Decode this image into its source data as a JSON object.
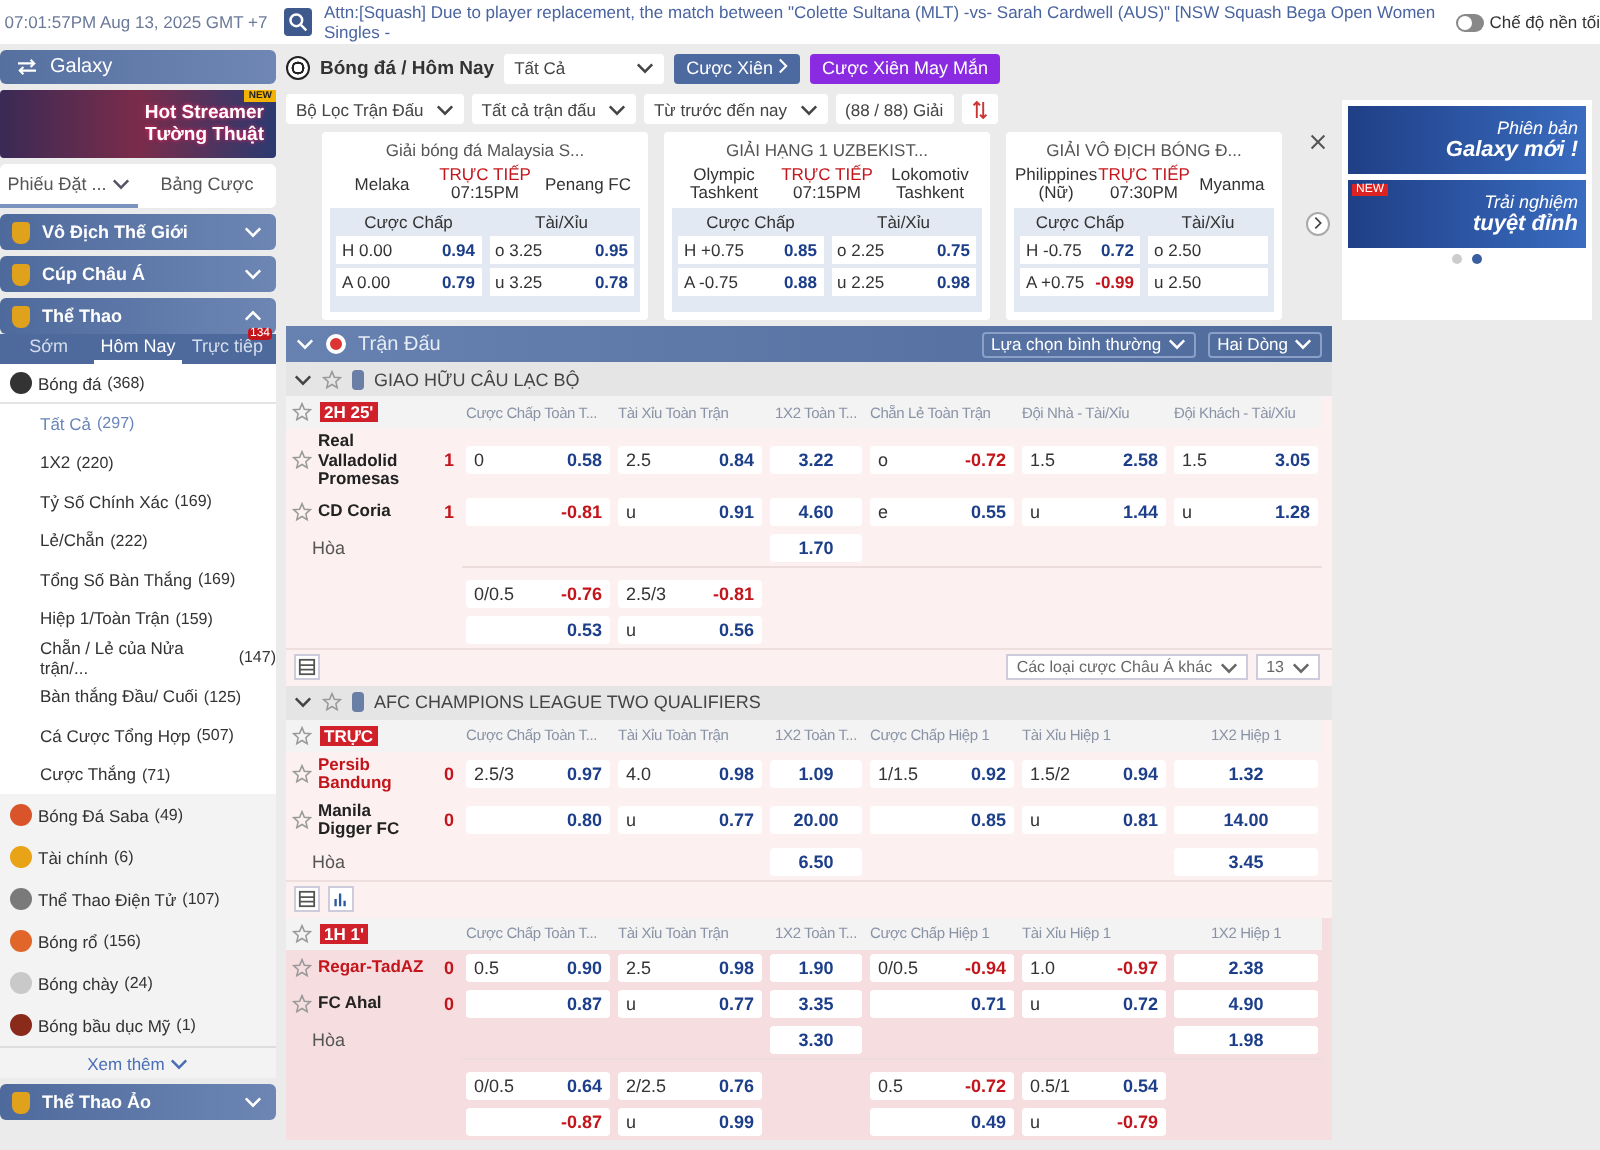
{
  "top_bar": {
    "clock": "07:01:57PM Aug 13, 2025 GMT +7",
    "ticker": "Attn:[Squash] Due to player replacement, the match between \"Colette Sultana (MLT) -vs- Sarah Cardwell (AUS)\" [NSW Squash Bega Open Women Singles -",
    "dark_mode": {
      "label": "Chế độ nền tối",
      "on": false
    }
  },
  "sidebar": {
    "brand": "Galaxy",
    "promo": {
      "badge": "NEW",
      "title": "Hot Streamer",
      "subtitle": "Tường Thuật"
    },
    "slip_tabs": [
      {
        "label": "Phiếu Đặt ...",
        "selected": true
      },
      {
        "label": "Bảng Cược",
        "selected": false
      }
    ],
    "sections": [
      {
        "title": "Vô Địch Thế Giới",
        "expanded": false
      },
      {
        "title": "Cúp Châu Á",
        "expanded": false
      },
      {
        "title": "Thể Thao",
        "expanded": true,
        "tabs": [
          {
            "label": "Sớm",
            "selected": false
          },
          {
            "label": "Hôm Nay",
            "selected": true
          },
          {
            "label": "Trực tiếp",
            "selected": false,
            "badge": "134"
          }
        ],
        "sports": [
          {
            "kind": "soccer",
            "name": "Bóng đá",
            "count": "(368)",
            "expanded": true,
            "children": [
              {
                "name": "Tất Cả",
                "count": "(297)",
                "selected": true
              },
              {
                "name": "1X2",
                "count": "(220)",
                "selected": false
              },
              {
                "name": "Tỷ Số Chính Xác",
                "count": "(169)",
                "selected": false
              },
              {
                "name": "Lẻ/Chẵn",
                "count": "(222)",
                "selected": false
              },
              {
                "name": "Tổng Số Bàn Thắng",
                "count": "(169)",
                "selected": false
              },
              {
                "name": "Hiệp 1/Toàn Trận",
                "count": "(159)",
                "selected": false
              },
              {
                "name": "Chẵn / Lẻ của Nửa trận/...",
                "count": "(147)",
                "selected": false
              },
              {
                "name": "Bàn thắng Đầu/ Cuối",
                "count": "(125)",
                "selected": false
              },
              {
                "name": "Cá Cược Tổng Hợp",
                "count": "(507)",
                "selected": false
              },
              {
                "name": "Cược Thắng",
                "count": "(71)",
                "selected": false
              }
            ]
          },
          {
            "kind": "saba",
            "name": "Bóng Đá Saba",
            "count": "(49)",
            "expanded": false
          },
          {
            "kind": "finance",
            "name": "Tài chính",
            "count": "(6)",
            "expanded": false
          },
          {
            "kind": "esports",
            "name": "Thể Thao Điện Tử",
            "count": "(107)",
            "expanded": false
          },
          {
            "kind": "basketball",
            "name": "Bóng rổ",
            "count": "(156)",
            "expanded": false
          },
          {
            "kind": "baseball",
            "name": "Bóng chày",
            "count": "(24)",
            "expanded": false
          },
          {
            "kind": "football",
            "name": "Bóng bầu dục Mỹ",
            "count": "(1)",
            "expanded": false
          }
        ],
        "more": "Xem thêm"
      },
      {
        "title": "Thể Thao Ảo",
        "expanded": false
      }
    ]
  },
  "main": {
    "header": {
      "title": "Bóng đá / Hôm Nay",
      "market_select": "Tất Cả",
      "parlay": "Cược Xiên",
      "lucky_parlay": "Cược Xiên May Mắn"
    },
    "filters": [
      "Bộ Lọc Trận Đấu",
      "Tất cả trận đấu",
      "Từ trước đến nay"
    ],
    "league_count": "(88 / 88) Giải",
    "featured": [
      {
        "league": "Giải bóng đá Malaysia S...",
        "home": "Melaka",
        "away": "Penang FC",
        "live": "TRỰC TIẾP",
        "time": "07:15PM",
        "markets": [
          {
            "title": "Cược Chấp",
            "rows": [
              {
                "side": "H",
                "line": "0.00",
                "odd": "0.94"
              },
              {
                "side": "A",
                "line": "0.00",
                "odd": "0.79"
              }
            ]
          },
          {
            "title": "Tài/Xỉu",
            "rows": [
              {
                "side": "o",
                "line": "3.25",
                "odd": "0.95"
              },
              {
                "side": "u",
                "line": "3.25",
                "odd": "0.78"
              }
            ]
          }
        ]
      },
      {
        "league": "GIẢI HẠNG 1 UZBEKIST...",
        "home": "Olympic Tashkent",
        "away": "Lokomotiv Tashkent",
        "live": "TRỰC TIẾP",
        "time": "07:15PM",
        "markets": [
          {
            "title": "Cược Chấp",
            "rows": [
              {
                "side": "H",
                "line": "+0.75",
                "odd": "0.85"
              },
              {
                "side": "A",
                "line": "-0.75",
                "odd": "0.88"
              }
            ]
          },
          {
            "title": "Tài/Xỉu",
            "rows": [
              {
                "side": "o",
                "line": "2.25",
                "odd": "0.75"
              },
              {
                "side": "u",
                "line": "2.25",
                "odd": "0.98"
              }
            ]
          }
        ]
      },
      {
        "league": "GIẢI VÔ ĐỊCH BÓNG Đ...",
        "home": "Philippines (Nữ)",
        "away": "Myanma",
        "live": "TRỰC TIẾP",
        "time": "07:30PM",
        "markets": [
          {
            "title": "Cược Chấp",
            "rows": [
              {
                "side": "H",
                "line": "-0.75",
                "odd": "0.72"
              },
              {
                "side": "A",
                "line": "+0.75",
                "odd": "-0.99"
              }
            ]
          },
          {
            "title": "Tài/Xỉu",
            "rows": [
              {
                "side": "o",
                "line": "2.50"
              },
              {
                "side": "u",
                "line": "2.50"
              }
            ]
          }
        ]
      }
    ],
    "matches_bar": {
      "title": "Trận Đấu",
      "options": [
        "Lựa chọn bình thường",
        "Hai Dòng"
      ]
    },
    "leagues": [
      {
        "name": "GIAO HỮU CÂU LẠC BỘ",
        "matches": [
          {
            "status": "2H 25'",
            "highlighted": false,
            "teams": [
              {
                "name": "Real Valladolid Promesas",
                "score": "1",
                "favorite": false
              },
              {
                "name": "CD Coria",
                "score": "1",
                "favorite": false
              }
            ],
            "draw": "Hòa",
            "headers": [
              {
                "label": "Cược Chấp Toàn T...",
                "kind": "line"
              },
              {
                "label": "Tài Xỉu Toàn Trận",
                "kind": "line"
              },
              {
                "label": "1X2 Toàn T...",
                "kind": "threeway"
              },
              {
                "label": "Chẵn Lẻ Toàn Trận",
                "kind": "line"
              },
              {
                "label": "Đội Nhà - Tài/Xỉu",
                "kind": "line"
              },
              {
                "label": "Đội Khách - Tài/Xỉu",
                "kind": "line"
              }
            ],
            "blocks": [
              [
                [
                  {
                    "kind": "odds",
                    "label": "0",
                    "odd": "0.58"
                  },
                  {
                    "kind": "odds",
                    "label": "2.5",
                    "odd": "0.84"
                  },
                  {
                    "kind": "odds",
                    "odd": "3.22"
                  },
                  {
                    "kind": "odds",
                    "label": "o",
                    "odd": "-0.72"
                  },
                  {
                    "kind": "odds",
                    "label": "1.5",
                    "odd": "2.58"
                  },
                  {
                    "kind": "odds",
                    "label": "1.5",
                    "odd": "3.05"
                  }
                ],
                [
                  {
                    "kind": "odds",
                    "odd": "-0.81"
                  },
                  {
                    "kind": "odds",
                    "label": "u",
                    "odd": "0.91"
                  },
                  {
                    "kind": "odds",
                    "odd": "4.60"
                  },
                  {
                    "kind": "odds",
                    "label": "e",
                    "odd": "0.55"
                  },
                  {
                    "kind": "odds",
                    "label": "u",
                    "odd": "1.44"
                  },
                  {
                    "kind": "odds",
                    "label": "u",
                    "odd": "1.28"
                  }
                ],
                [
                  {
                    "kind": "blank"
                  },
                  {
                    "kind": "blank"
                  },
                  {
                    "kind": "odds",
                    "odd": "1.70"
                  },
                  {
                    "kind": "blank"
                  },
                  {
                    "kind": "blank"
                  },
                  {
                    "kind": "blank"
                  }
                ]
              ],
              [
                [
                  {
                    "kind": "odds",
                    "label": "0/0.5",
                    "odd": "-0.76"
                  },
                  {
                    "kind": "odds",
                    "label": "2.5/3",
                    "odd": "-0.81"
                  },
                  {
                    "kind": "blank"
                  },
                  {
                    "kind": "blank"
                  },
                  {
                    "kind": "blank"
                  },
                  {
                    "kind": "blank"
                  }
                ],
                [
                  {
                    "kind": "odds",
                    "odd": "0.53"
                  },
                  {
                    "kind": "odds",
                    "label": "u",
                    "odd": "0.56"
                  },
                  {
                    "kind": "blank"
                  },
                  {
                    "kind": "blank"
                  },
                  {
                    "kind": "blank"
                  },
                  {
                    "kind": "blank"
                  }
                ]
              ]
            ],
            "footer": {
              "stats_button": false,
              "more_markets": "Các loại cược Châu Á khác",
              "line_count": "13"
            }
          }
        ]
      },
      {
        "name": "AFC CHAMPIONS LEAGUE TWO QUALIFIERS",
        "matches": [
          {
            "status": "TRỰC",
            "highlighted": false,
            "teams": [
              {
                "name": "Persib Bandung",
                "score": "0",
                "favorite": true
              },
              {
                "name": "Manila Digger FC",
                "score": "0",
                "favorite": false
              }
            ],
            "draw": "Hòa",
            "headers": [
              {
                "label": "Cược Chấp Toàn T...",
                "kind": "line"
              },
              {
                "label": "Tài Xỉu Toàn Trận",
                "kind": "line"
              },
              {
                "label": "1X2 Toàn T...",
                "kind": "threeway"
              },
              {
                "label": "Cược Chấp Hiệp 1",
                "kind": "line"
              },
              {
                "label": "Tài Xỉu Hiệp 1",
                "kind": "line"
              },
              {
                "label": "1X2 Hiệp 1",
                "kind": "threeway"
              }
            ],
            "blocks": [
              [
                [
                  {
                    "kind": "odds",
                    "label": "2.5/3",
                    "odd": "0.97"
                  },
                  {
                    "kind": "odds",
                    "label": "4.0",
                    "odd": "0.98"
                  },
                  {
                    "kind": "odds",
                    "odd": "1.09"
                  },
                  {
                    "kind": "odds",
                    "label": "1/1.5",
                    "odd": "0.92"
                  },
                  {
                    "kind": "odds",
                    "label": "1.5/2",
                    "odd": "0.94"
                  },
                  {
                    "kind": "odds",
                    "odd": "1.32"
                  }
                ],
                [
                  {
                    "kind": "odds",
                    "odd": "0.80"
                  },
                  {
                    "kind": "odds",
                    "label": "u",
                    "odd": "0.77"
                  },
                  {
                    "kind": "odds",
                    "odd": "20.00"
                  },
                  {
                    "kind": "odds",
                    "odd": "0.85"
                  },
                  {
                    "kind": "odds",
                    "label": "u",
                    "odd": "0.81"
                  },
                  {
                    "kind": "odds",
                    "odd": "14.00"
                  }
                ],
                [
                  {
                    "kind": "blank"
                  },
                  {
                    "kind": "blank"
                  },
                  {
                    "kind": "odds",
                    "odd": "6.50"
                  },
                  {
                    "kind": "blank"
                  },
                  {
                    "kind": "blank"
                  },
                  {
                    "kind": "odds",
                    "odd": "3.45"
                  }
                ]
              ]
            ],
            "footer": {
              "stats_button": true
            }
          },
          {
            "status": "1H 1'",
            "highlighted": true,
            "teams": [
              {
                "name": "Regar-TadAZ",
                "score": "0",
                "favorite": true
              },
              {
                "name": "FC Ahal",
                "score": "0",
                "favorite": false
              }
            ],
            "draw": "Hòa",
            "headers": [
              {
                "label": "Cược Chấp Toàn T...",
                "kind": "line"
              },
              {
                "label": "Tài Xỉu Toàn Trận",
                "kind": "line"
              },
              {
                "label": "1X2 Toàn T...",
                "kind": "threeway"
              },
              {
                "label": "Cược Chấp Hiệp 1",
                "kind": "line"
              },
              {
                "label": "Tài Xỉu Hiệp 1",
                "kind": "line"
              },
              {
                "label": "1X2 Hiệp 1",
                "kind": "threeway"
              }
            ],
            "blocks": [
              [
                [
                  {
                    "kind": "odds",
                    "label": "0.5",
                    "odd": "0.90"
                  },
                  {
                    "kind": "odds",
                    "label": "2.5",
                    "odd": "0.98"
                  },
                  {
                    "kind": "odds",
                    "odd": "1.90"
                  },
                  {
                    "kind": "odds",
                    "label": "0/0.5",
                    "odd": "-0.94"
                  },
                  {
                    "kind": "odds",
                    "label": "1.0",
                    "odd": "-0.97"
                  },
                  {
                    "kind": "odds",
                    "odd": "2.38"
                  }
                ],
                [
                  {
                    "kind": "odds",
                    "odd": "0.87"
                  },
                  {
                    "kind": "odds",
                    "label": "u",
                    "odd": "0.77"
                  },
                  {
                    "kind": "odds",
                    "odd": "3.35"
                  },
                  {
                    "kind": "odds",
                    "odd": "0.71"
                  },
                  {
                    "kind": "odds",
                    "label": "u",
                    "odd": "0.72"
                  },
                  {
                    "kind": "odds",
                    "odd": "4.90"
                  }
                ],
                [
                  {
                    "kind": "blank"
                  },
                  {
                    "kind": "blank"
                  },
                  {
                    "kind": "odds",
                    "odd": "3.30"
                  },
                  {
                    "kind": "blank"
                  },
                  {
                    "kind": "blank"
                  },
                  {
                    "kind": "odds",
                    "odd": "1.98"
                  }
                ]
              ],
              [
                [
                  {
                    "kind": "odds",
                    "label": "0/0.5",
                    "odd": "0.64"
                  },
                  {
                    "kind": "odds",
                    "label": "2/2.5",
                    "odd": "0.76"
                  },
                  {
                    "kind": "blank"
                  },
                  {
                    "kind": "odds",
                    "label": "0.5",
                    "odd": "-0.72"
                  },
                  {
                    "kind": "odds",
                    "label": "0.5/1",
                    "odd": "0.54"
                  },
                  {
                    "kind": "blank"
                  }
                ],
                [
                  {
                    "kind": "odds",
                    "odd": "-0.87"
                  },
                  {
                    "kind": "odds",
                    "label": "u",
                    "odd": "0.99"
                  },
                  {
                    "kind": "blank"
                  },
                  {
                    "kind": "odds",
                    "odd": "0.49"
                  },
                  {
                    "kind": "odds",
                    "label": "u",
                    "odd": "-0.79"
                  },
                  {
                    "kind": "blank"
                  }
                ]
              ]
            ]
          }
        ]
      }
    ]
  },
  "ads": [
    {
      "line1": "Phiên bản",
      "line2": "Galaxy mới !",
      "selected": false
    },
    {
      "badge": "NEW",
      "line1": "Trải nghiệm",
      "line2": "tuyệt đỉnh",
      "selected": true
    }
  ]
}
